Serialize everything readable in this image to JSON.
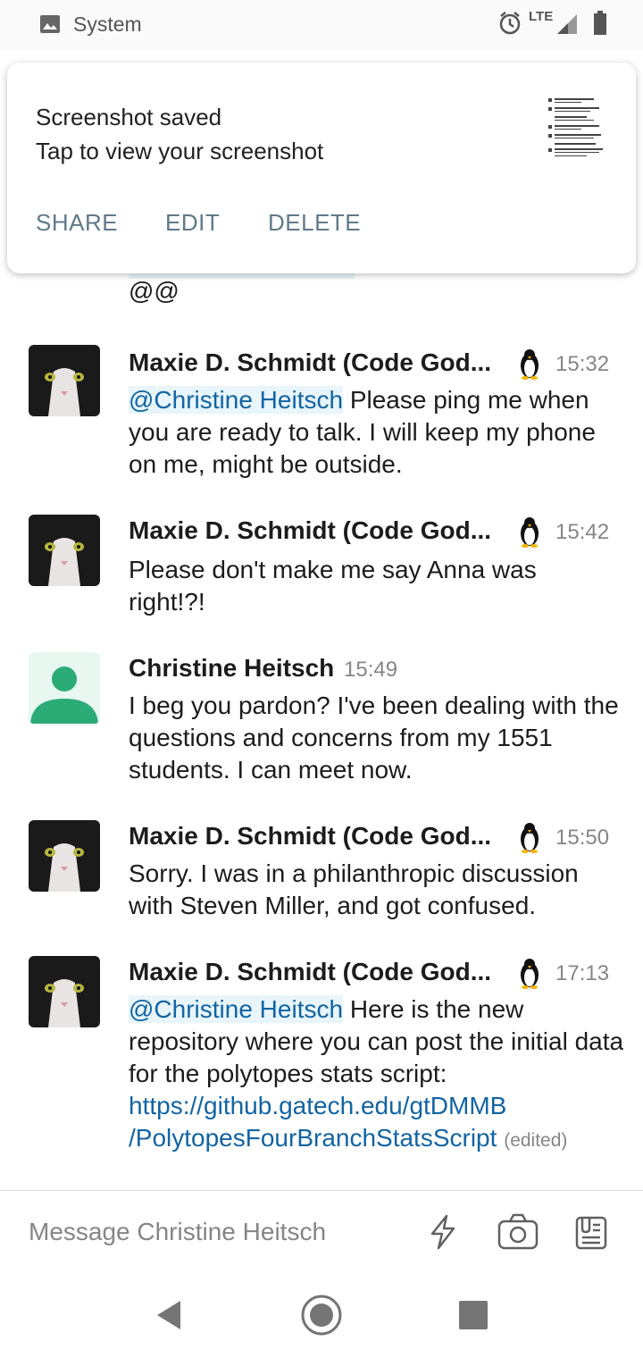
{
  "status_bar": {
    "notification_label": "System",
    "network": "LTE"
  },
  "notification": {
    "title": "Screenshot saved",
    "subtitle": "Tap to view your screenshot",
    "actions": [
      "SHARE",
      "EDIT",
      "DELETE"
    ]
  },
  "chat": {
    "partial_message_tail": "@@",
    "messages": [
      {
        "author": "Maxie D. Schmidt (Code God...",
        "time": "15:32",
        "mention": "@Christine Heitsch",
        "text": " Please ping me when you are ready to talk. I will keep my phone on me, might be outside."
      },
      {
        "author": "Maxie D. Schmidt (Code God...",
        "time": "15:42",
        "text": "Please don't make me say Anna was right!?!"
      },
      {
        "author": "Christine Heitsch",
        "time": "15:49",
        "text": "I beg you pardon?  I've been dealing with the questions and concerns from my 1551 students.  I can meet now."
      },
      {
        "author": "Maxie D. Schmidt (Code God...",
        "time": "15:50",
        "text": "Sorry. I was in a philanthropic discussion with Steven Miller, and got confused."
      },
      {
        "author": "Maxie D. Schmidt (Code God...",
        "time": "17:13",
        "mention": "@Christine Heitsch",
        "text": " Here is the new repository where you can post the initial data for the polytopes stats script: ",
        "link_line1": "https://github.gatech.edu/gtDMMB",
        "link_line2": "/PolytopesFourBranchStatsScript",
        "edited": "(edited)"
      }
    ]
  },
  "composer": {
    "placeholder": "Message Christine Heitsch"
  },
  "colors": {
    "link": "#1264a3",
    "mention_bg": "#e8f5fa",
    "action_text": "#5f7a89",
    "default_avatar": "#2bac76"
  }
}
